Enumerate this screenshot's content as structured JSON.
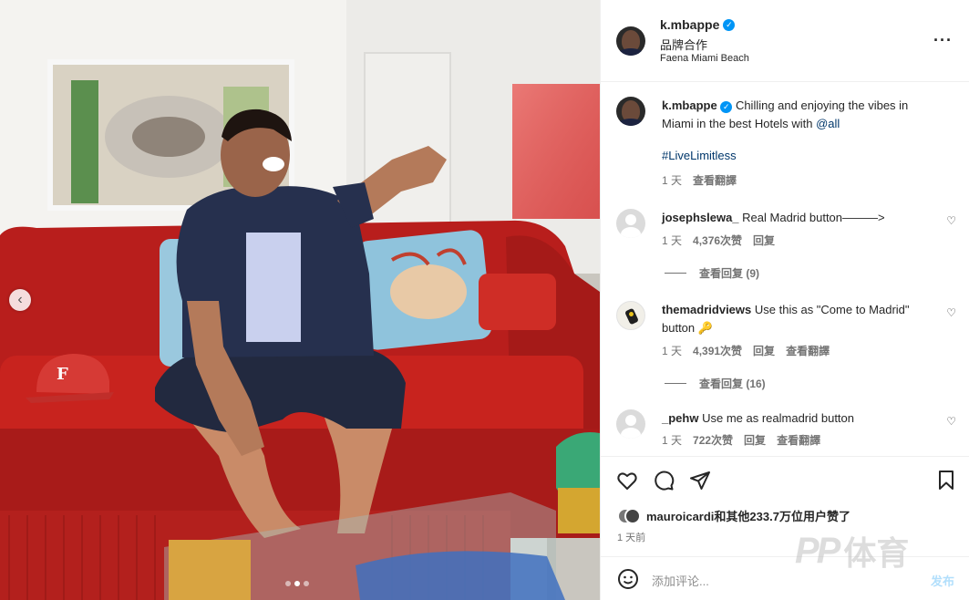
{
  "post": {
    "username": "k.mbappe",
    "subtitle": "品牌合作",
    "location": "Faena Miami Beach",
    "more_icon": "more-horizontal-icon"
  },
  "caption": {
    "username": "k.mbappe",
    "text": "Chilling and enjoying the vibes in Miami in the best Hotels with",
    "mention": "@all",
    "hashtag": "#LiveLimitless",
    "time": "1 天",
    "translate": "查看翻譯"
  },
  "comments": [
    {
      "username": "josephslewa_",
      "text": "Real Madrid button———>",
      "time": "1 天",
      "likes": "4,376次赞",
      "reply": "回复",
      "view_replies": "查看回复 (9)"
    },
    {
      "username": "themadridviews",
      "text": "Use this as \"Come to Madrid\" button 🔑",
      "time": "1 天",
      "likes": "4,391次赞",
      "reply": "回复",
      "translate": "查看翻譯",
      "view_replies": "查看回复 (16)"
    },
    {
      "username": "_pehw",
      "text": "Use me as realmadrid button",
      "time": "1 天",
      "likes": "722次赞",
      "reply": "回复",
      "translate": "查看翻譯"
    }
  ],
  "likes_line": "mauroicardi和其他233.7万位用户赞了",
  "time_ago": "1 天前",
  "compose": {
    "placeholder": "添加评论...",
    "post_label": "发布"
  },
  "watermark": {
    "logo": "PP",
    "text": "体育"
  },
  "carousel": {
    "prev": "‹",
    "dots": 3,
    "active": 1
  },
  "colors": {
    "link": "#00376b",
    "verified": "#0095f6",
    "post_disabled": "#b2dffc",
    "sofa": "#c8231e"
  }
}
